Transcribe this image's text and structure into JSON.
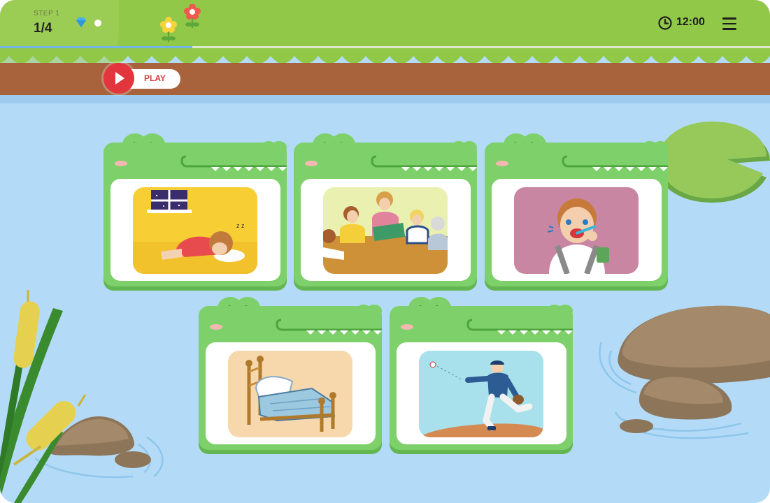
{
  "header": {
    "step_label": "STEP 1",
    "step_count": "1/4",
    "timer": "12:00",
    "progress": 0.25,
    "icons": [
      "gem-icon",
      "dot-icon",
      "flower-icon",
      "clock-icon",
      "menu-icon"
    ]
  },
  "play": {
    "label": "PLAY",
    "icon": "play-icon"
  },
  "cards": [
    {
      "id": "sleeping",
      "picture": "girl-sleeping-picture"
    },
    {
      "id": "reading",
      "picture": "teacher-reading-picture"
    },
    {
      "id": "brushing",
      "picture": "boy-brushing-teeth-picture"
    },
    {
      "id": "bed",
      "picture": "bed-picture"
    },
    {
      "id": "baseball",
      "picture": "baseball-pitcher-picture"
    }
  ],
  "colors": {
    "grass": "#92c848",
    "dirt": "#a8623c",
    "water": "#b3dbf7",
    "croc": "#7ed06a",
    "croc_dark": "#64b653",
    "play_red": "#e3353d"
  }
}
